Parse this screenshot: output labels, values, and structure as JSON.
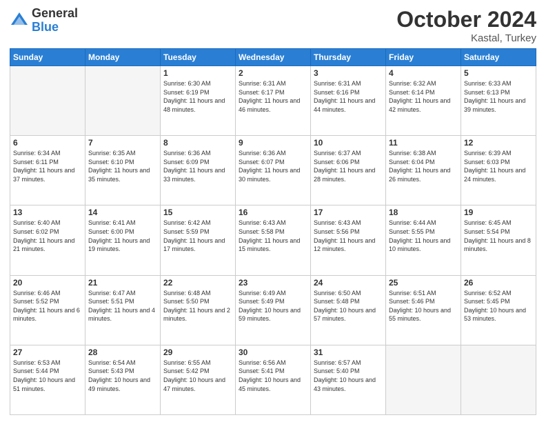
{
  "header": {
    "logo_general": "General",
    "logo_blue": "Blue",
    "month": "October 2024",
    "location": "Kastal, Turkey"
  },
  "days_of_week": [
    "Sunday",
    "Monday",
    "Tuesday",
    "Wednesday",
    "Thursday",
    "Friday",
    "Saturday"
  ],
  "weeks": [
    [
      {
        "day": "",
        "empty": true
      },
      {
        "day": "",
        "empty": true
      },
      {
        "day": "1",
        "sunrise": "6:30 AM",
        "sunset": "6:19 PM",
        "daylight": "11 hours and 48 minutes."
      },
      {
        "day": "2",
        "sunrise": "6:31 AM",
        "sunset": "6:17 PM",
        "daylight": "11 hours and 46 minutes."
      },
      {
        "day": "3",
        "sunrise": "6:31 AM",
        "sunset": "6:16 PM",
        "daylight": "11 hours and 44 minutes."
      },
      {
        "day": "4",
        "sunrise": "6:32 AM",
        "sunset": "6:14 PM",
        "daylight": "11 hours and 42 minutes."
      },
      {
        "day": "5",
        "sunrise": "6:33 AM",
        "sunset": "6:13 PM",
        "daylight": "11 hours and 39 minutes."
      }
    ],
    [
      {
        "day": "6",
        "sunrise": "6:34 AM",
        "sunset": "6:11 PM",
        "daylight": "11 hours and 37 minutes."
      },
      {
        "day": "7",
        "sunrise": "6:35 AM",
        "sunset": "6:10 PM",
        "daylight": "11 hours and 35 minutes."
      },
      {
        "day": "8",
        "sunrise": "6:36 AM",
        "sunset": "6:09 PM",
        "daylight": "11 hours and 33 minutes."
      },
      {
        "day": "9",
        "sunrise": "6:36 AM",
        "sunset": "6:07 PM",
        "daylight": "11 hours and 30 minutes."
      },
      {
        "day": "10",
        "sunrise": "6:37 AM",
        "sunset": "6:06 PM",
        "daylight": "11 hours and 28 minutes."
      },
      {
        "day": "11",
        "sunrise": "6:38 AM",
        "sunset": "6:04 PM",
        "daylight": "11 hours and 26 minutes."
      },
      {
        "day": "12",
        "sunrise": "6:39 AM",
        "sunset": "6:03 PM",
        "daylight": "11 hours and 24 minutes."
      }
    ],
    [
      {
        "day": "13",
        "sunrise": "6:40 AM",
        "sunset": "6:02 PM",
        "daylight": "11 hours and 21 minutes."
      },
      {
        "day": "14",
        "sunrise": "6:41 AM",
        "sunset": "6:00 PM",
        "daylight": "11 hours and 19 minutes."
      },
      {
        "day": "15",
        "sunrise": "6:42 AM",
        "sunset": "5:59 PM",
        "daylight": "11 hours and 17 minutes."
      },
      {
        "day": "16",
        "sunrise": "6:43 AM",
        "sunset": "5:58 PM",
        "daylight": "11 hours and 15 minutes."
      },
      {
        "day": "17",
        "sunrise": "6:43 AM",
        "sunset": "5:56 PM",
        "daylight": "11 hours and 12 minutes."
      },
      {
        "day": "18",
        "sunrise": "6:44 AM",
        "sunset": "5:55 PM",
        "daylight": "11 hours and 10 minutes."
      },
      {
        "day": "19",
        "sunrise": "6:45 AM",
        "sunset": "5:54 PM",
        "daylight": "11 hours and 8 minutes."
      }
    ],
    [
      {
        "day": "20",
        "sunrise": "6:46 AM",
        "sunset": "5:52 PM",
        "daylight": "11 hours and 6 minutes."
      },
      {
        "day": "21",
        "sunrise": "6:47 AM",
        "sunset": "5:51 PM",
        "daylight": "11 hours and 4 minutes."
      },
      {
        "day": "22",
        "sunrise": "6:48 AM",
        "sunset": "5:50 PM",
        "daylight": "11 hours and 2 minutes."
      },
      {
        "day": "23",
        "sunrise": "6:49 AM",
        "sunset": "5:49 PM",
        "daylight": "10 hours and 59 minutes."
      },
      {
        "day": "24",
        "sunrise": "6:50 AM",
        "sunset": "5:48 PM",
        "daylight": "10 hours and 57 minutes."
      },
      {
        "day": "25",
        "sunrise": "6:51 AM",
        "sunset": "5:46 PM",
        "daylight": "10 hours and 55 minutes."
      },
      {
        "day": "26",
        "sunrise": "6:52 AM",
        "sunset": "5:45 PM",
        "daylight": "10 hours and 53 minutes."
      }
    ],
    [
      {
        "day": "27",
        "sunrise": "6:53 AM",
        "sunset": "5:44 PM",
        "daylight": "10 hours and 51 minutes."
      },
      {
        "day": "28",
        "sunrise": "6:54 AM",
        "sunset": "5:43 PM",
        "daylight": "10 hours and 49 minutes."
      },
      {
        "day": "29",
        "sunrise": "6:55 AM",
        "sunset": "5:42 PM",
        "daylight": "10 hours and 47 minutes."
      },
      {
        "day": "30",
        "sunrise": "6:56 AM",
        "sunset": "5:41 PM",
        "daylight": "10 hours and 45 minutes."
      },
      {
        "day": "31",
        "sunrise": "6:57 AM",
        "sunset": "5:40 PM",
        "daylight": "10 hours and 43 minutes."
      },
      {
        "day": "",
        "empty": true
      },
      {
        "day": "",
        "empty": true
      }
    ]
  ]
}
